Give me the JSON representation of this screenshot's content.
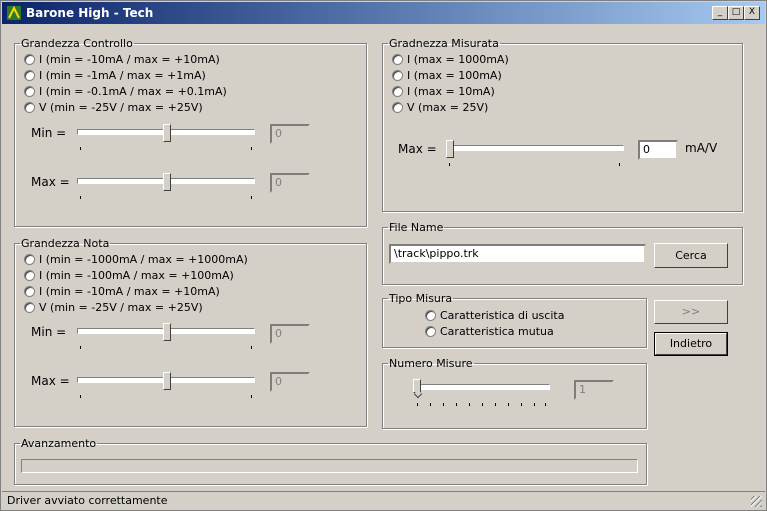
{
  "window": {
    "title": "Barone High - Tech",
    "min": "_",
    "max": "□",
    "close": "X"
  },
  "controllo": {
    "legend": "Grandezza Controllo",
    "options": [
      "I (min = -10mA / max = +10mA)",
      "I (min = -1mA / max = +1mA)",
      "I (min = -0.1mA / max = +0.1mA)",
      "V (min = -25V / max = +25V)"
    ],
    "min_label": "Min =",
    "min_value": "0",
    "max_label": "Max =",
    "max_value": "0"
  },
  "nota": {
    "legend": "Grandezza Nota",
    "options": [
      "I (min = -1000mA / max = +1000mA)",
      "I (min = -100mA / max = +100mA)",
      "I (min = -10mA / max = +10mA)",
      "V (min = -25V / max = +25V)"
    ],
    "min_label": "Min =",
    "min_value": "0",
    "max_label": "Max =",
    "max_value": "0"
  },
  "misurata": {
    "legend": "Gradnezza Misurata",
    "options": [
      "I (max = 1000mA)",
      "I (max = 100mA)",
      "I (max = 10mA)",
      "V (max = 25V)"
    ],
    "max_label": "Max =",
    "max_value": "0",
    "unit": "mA/V"
  },
  "file": {
    "legend": "File Name",
    "value": "\\track\\pippo.trk",
    "button": "Cerca"
  },
  "tipo": {
    "legend": "Tipo Misura",
    "options": [
      "Caratteristica di uscita",
      "Caratteristica mutua"
    ]
  },
  "buttons": {
    "next": ">>",
    "back": "Indietro"
  },
  "numero": {
    "legend": "Numero Misure",
    "value": "1"
  },
  "avanzamento": {
    "legend": "Avanzamento",
    "progress": 0
  },
  "status": "Driver avviato correttamente"
}
